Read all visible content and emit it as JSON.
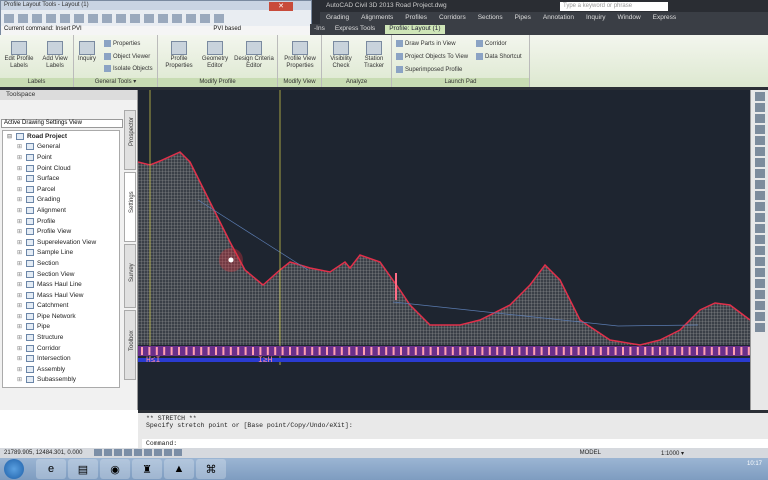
{
  "app": {
    "title": "AutoCAD Civil 3D 2013   Road Project.dwg",
    "search_placeholder": "Type a keyword or phrase"
  },
  "menu": [
    "Grading",
    "Alignments",
    "Profiles",
    "Corridors",
    "Sections",
    "Pipes",
    "Annotation",
    "Inquiry",
    "Window",
    "Express"
  ],
  "ribbon_tabs": [
    "-Ins",
    "Express Tools",
    "Profile: Layout (1)"
  ],
  "profile_layout_tools": {
    "title": "Profile Layout Tools - Layout (1)",
    "current_command": "Current command: Insert PVI",
    "mode": "PVI based",
    "close": "✕"
  },
  "ribbon": {
    "groups": [
      {
        "label": "Labels",
        "buttons": [
          "Edit Profile Labels",
          "Add View Labels"
        ]
      },
      {
        "label": "General Tools ▾",
        "buttons": [
          "Inquiry"
        ],
        "small": [
          "Properties",
          "Object Viewer",
          "Isolate Objects"
        ]
      },
      {
        "label": "Modify Profile",
        "buttons": [
          "Profile Properties",
          "Geometry Editor",
          "Design Criteria Editor"
        ]
      },
      {
        "label": "Modify View",
        "buttons": [
          "Profile View Properties"
        ]
      },
      {
        "label": "Analyze",
        "buttons": [
          "Visibility Check",
          "Station Tracker"
        ]
      },
      {
        "label": "Launch Pad",
        "small": [
          "Draw Parts in View",
          "Project Objects To View",
          "Superimposed Profile",
          "Corridor",
          "Data Shortcut"
        ]
      }
    ]
  },
  "toolspace": {
    "title": "Toolspace",
    "view": "Active Drawing Settings View",
    "root": "Road Project",
    "items": [
      "General",
      "Point",
      "Point Cloud",
      "Surface",
      "Parcel",
      "Grading",
      "Alignment",
      "Profile",
      "Profile View",
      "Superelevation View",
      "Sample Line",
      "Section",
      "Section View",
      "Mass Haul Line",
      "Mass Haul View",
      "Catchment",
      "Pipe Network",
      "Pipe",
      "Structure",
      "Corridor",
      "Intersection",
      "Assembly",
      "Subassembly"
    ],
    "tabs": [
      "Prospector",
      "Settings",
      "Survey",
      "Toolbox"
    ]
  },
  "command": {
    "line1": "** STRETCH **",
    "line2": "Specify stretch point or [Base point/Copy/Undo/eXit]:",
    "prompt": "Command:"
  },
  "status": {
    "coords": "21789.905, 12484.301, 0.000",
    "model": "MODEL",
    "scale": "1:1000 ▾"
  },
  "taskbar": {
    "clock": "10:17"
  },
  "colors": {
    "canvas": "#1e2530",
    "profile": "#e0304a",
    "hatch": "#9a9a9a",
    "band": "#2a3bd0"
  }
}
